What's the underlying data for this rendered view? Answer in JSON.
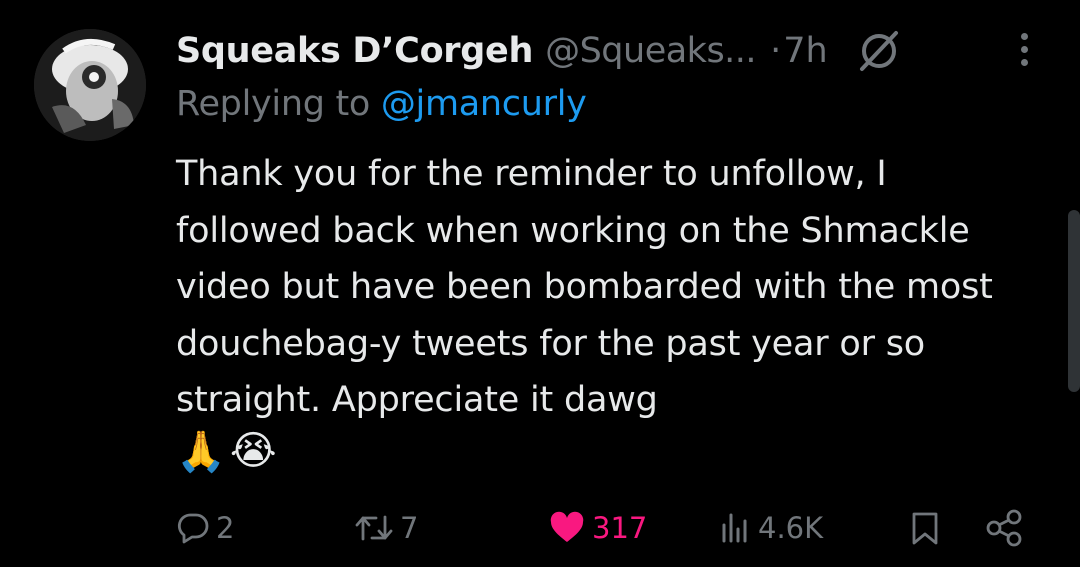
{
  "tweet": {
    "author_name": "Squeaks D’Corgeh",
    "author_handle": "@Squeaks...",
    "separator": "·",
    "time": "7h",
    "replying_prefix": "Replying to ",
    "replying_handle": "@jmancurly",
    "text": "Thank you for the reminder to unfollow, I followed back when working on the Shmackle video but have been bombarded with the most douchebag-y tweets for the past year or so straight. Appreciate it dawg",
    "emoji_1": "🙏",
    "emoji_2": "😭"
  },
  "actions": {
    "reply_count": "2",
    "retweet_count": "7",
    "like_count": "317",
    "view_count": "4.6K"
  },
  "icons": {
    "verified": "verified-badge-icon",
    "reply": "comment-bubble-icon",
    "retweet": "retweet-icon",
    "like": "heart-icon",
    "views": "bar-chart-icon",
    "bookmark": "bookmark-icon",
    "share": "share-icon",
    "more": "more-vertical-icon"
  },
  "colors": {
    "background": "#000000",
    "text": "#e7e9ea",
    "muted": "#71767b",
    "link": "#1d9bf0",
    "like": "#f91880"
  }
}
